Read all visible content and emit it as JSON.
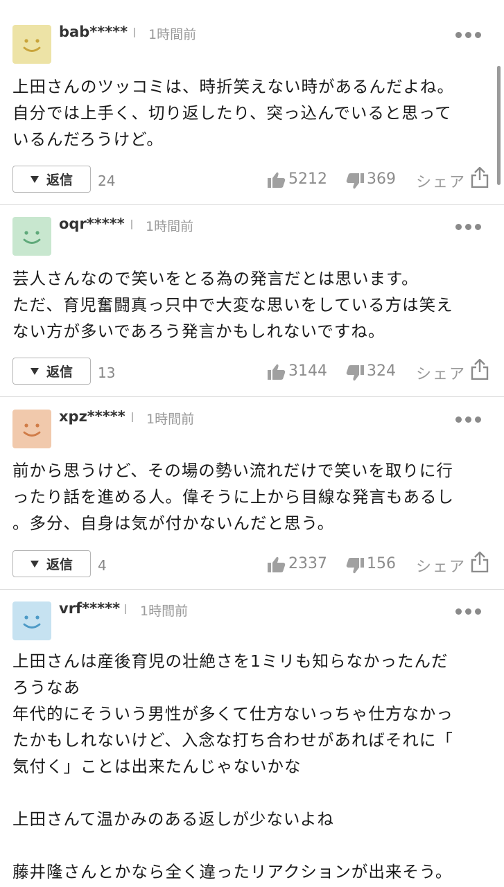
{
  "reply_label": "返信",
  "share_label": "シェア",
  "comments": [
    {
      "user": "bab*****",
      "time": "1時間前",
      "avatar_color": "#ede3a6",
      "face_color": "#c9a43b",
      "lines": [
        "上田さんのツッコミは、時折笑えない時があるんだよね。",
        "自分では上手く、切り返したり、突っ込んでいると思って",
        "いるんだろうけど。"
      ],
      "replies": "24",
      "likes": "5212",
      "dislikes": "369"
    },
    {
      "user": "oqr*****",
      "time": "1時間前",
      "avatar_color": "#c8e7cf",
      "face_color": "#5fa97a",
      "lines": [
        "芸人さんなので笑いをとる為の発言だとは思います。",
        "ただ、育児奮闘真っ只中で大変な思いをしている方は笑え",
        "ない方が多いであろう発言かもしれないですね。"
      ],
      "replies": "13",
      "likes": "3144",
      "dislikes": "324"
    },
    {
      "user": "xpz*****",
      "time": "1時間前",
      "avatar_color": "#f1c9ac",
      "face_color": "#d07c48",
      "lines": [
        "前から思うけど、その場の勢い流れだけで笑いを取りに行",
        "ったり話を進める人。偉そうに上から目線な発言もあるし",
        "。多分、自身は気が付かないんだと思う。"
      ],
      "replies": "4",
      "likes": "2337",
      "dislikes": "156"
    },
    {
      "user": "vrf*****",
      "time": "1時間前",
      "avatar_color": "#c6e2f1",
      "face_color": "#4d9ac6",
      "lines": [
        "上田さんは産後育児の壮絶さを1ミリも知らなかったんだ",
        "ろうなあ",
        "年代的にそういう男性が多くて仕方ないっちゃ仕方なかっ",
        "たかもしれないけど、入念な打ち合わせがあればそれに「",
        "気付く」ことは出来たんじゃないかな",
        "",
        "上田さんて温かみのある返しが少ないよね",
        "",
        "藤井隆さんとかなら全く違ったリアクションが出来そう。"
      ]
    }
  ]
}
